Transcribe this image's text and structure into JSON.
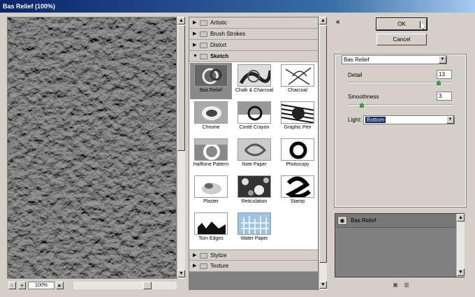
{
  "window": {
    "title": "Bas Relief (100%)"
  },
  "zoom": {
    "value": "100%",
    "minus": "-",
    "plus": "+"
  },
  "categories_top": [
    "Artistic",
    "Brush Strokes",
    "Distort",
    "Sketch"
  ],
  "categories_bottom": [
    "Stylize",
    "Texture"
  ],
  "filters": [
    "Bas Relief",
    "Chalk & Charcoal",
    "Charcoal",
    "Chrome",
    "Conté Crayon",
    "Graphic Pen",
    "Halftone Pattern",
    "Note Paper",
    "Photocopy",
    "Plaster",
    "Reticulation",
    "Stamp",
    "Torn Edges",
    "Water Paper"
  ],
  "selected_filter": "Bas Relief",
  "buttons": {
    "ok": "OK",
    "cancel": "Cancel",
    "collapse": "«"
  },
  "settings": {
    "filter_select": "Bas Relief",
    "detail_label": "Detail",
    "detail_value": "13",
    "detail_fraction": 0.867,
    "smoothness_label": "Smoothness",
    "smoothness_value": "3",
    "smoothness_fraction": 0.133,
    "light_label": "Light:",
    "light_value": "Bottom"
  },
  "layers": {
    "row": "Bas Relief"
  },
  "colors": {
    "selected_bg": "#8a8a8a",
    "dropdown_highlight": "#0a246a",
    "slider_knob": "#2f9d4a"
  }
}
